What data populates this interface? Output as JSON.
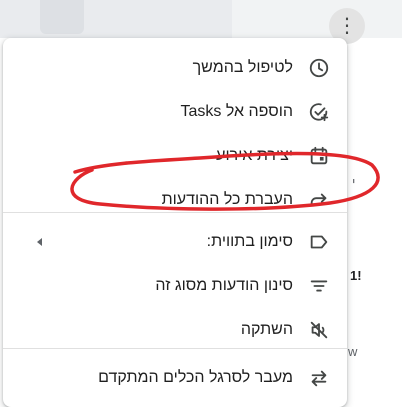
{
  "background": {
    "partial_texts": [
      "י",
      "1!",
      "w"
    ]
  },
  "menu": {
    "items": [
      {
        "label": "לטיפול בהמשך",
        "icon": "clock-icon"
      },
      {
        "label": "הוספה אל Tasks",
        "icon": "add-task-icon"
      },
      {
        "label": "יצירת אירוע",
        "icon": "calendar-icon"
      },
      {
        "label": "העברת כל ההודעות",
        "icon": "forward-arrow-icon"
      },
      {
        "label": "סימון בתווית:",
        "icon": "label-icon"
      },
      {
        "label": "סינון הודעות מסוג זה",
        "icon": "filter-icon"
      },
      {
        "label": "השתקה",
        "icon": "mute-icon"
      },
      {
        "label": "מעבר לסרגל הכלים המתקדם",
        "icon": "swap-icon"
      }
    ]
  },
  "colors": {
    "icon": "#444746",
    "annotation": "#e0272b"
  }
}
